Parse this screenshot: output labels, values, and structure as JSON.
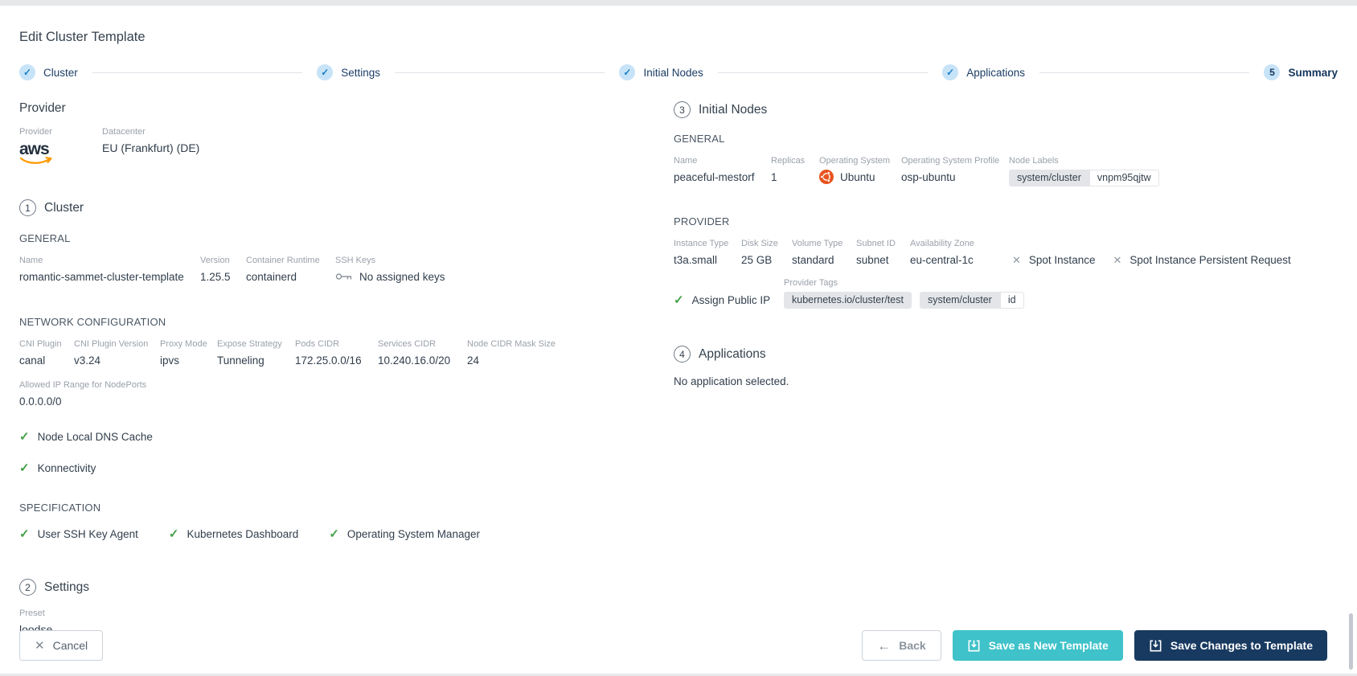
{
  "header": {
    "title": "Edit Cluster Template"
  },
  "icons": {
    "check": "✓",
    "close": "✕",
    "back_arrow": "←"
  },
  "colors": {
    "step_circle_bg": "#c7e3f8",
    "step_check": "#1b7fc4",
    "step_label_navy": "#1c3e66",
    "green_check": "#43a047",
    "gray_x": "#8f979f",
    "teal_button": "#3fc2c9",
    "navy_button": "#183a60",
    "chip_bg": "#e3e5e8",
    "ubuntu_orange": "#e95420",
    "aws_orange": "#ff9900"
  },
  "stepper": {
    "steps": [
      {
        "label": "Cluster",
        "state": "done"
      },
      {
        "label": "Settings",
        "state": "done"
      },
      {
        "label": "Initial Nodes",
        "state": "done"
      },
      {
        "label": "Applications",
        "state": "done"
      },
      {
        "label": "Summary",
        "state": "current",
        "number": "5"
      }
    ]
  },
  "provider": {
    "heading": "Provider",
    "provider_label": "Provider",
    "provider_value": "aws",
    "datacenter_label": "Datacenter",
    "datacenter_value": "EU (Frankfurt) (DE)"
  },
  "cluster": {
    "number": "1",
    "heading": "Cluster",
    "general": {
      "heading": "GENERAL",
      "name_label": "Name",
      "name": "romantic-sammet-cluster-template",
      "version_label": "Version",
      "version": "1.25.5",
      "runtime_label": "Container Runtime",
      "runtime": "containerd",
      "ssh_label": "SSH Keys",
      "ssh_value": "No assigned keys"
    },
    "network": {
      "heading": "NETWORK CONFIGURATION",
      "fields": [
        {
          "label": "CNI Plugin",
          "value": "canal"
        },
        {
          "label": "CNI Plugin Version",
          "value": "v3.24"
        },
        {
          "label": "Proxy Mode",
          "value": "ipvs"
        },
        {
          "label": "Expose Strategy",
          "value": "Tunneling"
        },
        {
          "label": "Pods CIDR",
          "value": "172.25.0.0/16"
        },
        {
          "label": "Services CIDR",
          "value": "10.240.16.0/20"
        },
        {
          "label": "Node CIDR Mask Size",
          "value": "24"
        }
      ],
      "allowed_ip_label": "Allowed IP Range for NodePorts",
      "allowed_ip_value": "0.0.0.0/0",
      "checks": [
        "Node Local DNS Cache",
        "Konnectivity"
      ]
    },
    "specification": {
      "heading": "SPECIFICATION",
      "checks": [
        "User SSH Key Agent",
        "Kubernetes Dashboard",
        "Operating System Manager"
      ]
    }
  },
  "settings": {
    "number": "2",
    "heading": "Settings",
    "preset_label": "Preset",
    "preset_value": "loodse"
  },
  "initial_nodes": {
    "number": "3",
    "heading": "Initial Nodes",
    "general": {
      "heading": "GENERAL",
      "name_label": "Name",
      "name": "peaceful-mestorf",
      "replicas_label": "Replicas",
      "replicas": "1",
      "os_label": "Operating System",
      "os": "Ubuntu",
      "osp_label": "Operating System Profile",
      "osp": "osp-ubuntu",
      "node_labels_label": "Node Labels",
      "node_label_key": "system/cluster",
      "node_label_value": "vnpm95qjtw"
    },
    "provider": {
      "heading": "PROVIDER",
      "fields": [
        {
          "label": "Instance Type",
          "value": "t3a.small"
        },
        {
          "label": "Disk Size",
          "value": "25 GB"
        },
        {
          "label": "Volume Type",
          "value": "standard"
        },
        {
          "label": "Subnet ID",
          "value": "subnet"
        },
        {
          "label": "Availability Zone",
          "value": "eu-central-1c"
        }
      ],
      "spot_instance": "Spot Instance",
      "spot_persistent": "Spot Instance Persistent Request",
      "assign_public_ip": "Assign Public IP",
      "provider_tags_label": "Provider Tags",
      "tag1": "kubernetes.io/cluster/test",
      "tag2_key": "system/cluster",
      "tag2_value": "id"
    }
  },
  "applications": {
    "number": "4",
    "heading": "Applications",
    "empty_text": "No application selected."
  },
  "footer": {
    "cancel": "Cancel",
    "back": "Back",
    "save_new": "Save as New Template",
    "save_changes": "Save Changes to Template"
  }
}
